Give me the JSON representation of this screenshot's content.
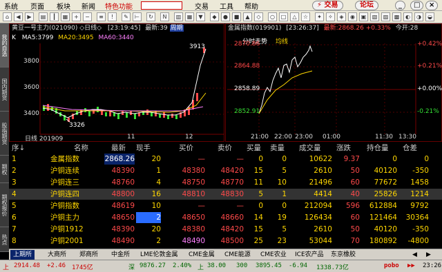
{
  "colors": {
    "up": "#ff4a4a",
    "down": "#35e035",
    "accent": "#ffd700",
    "highlight": "#0a246a"
  },
  "menu": {
    "items": [
      "系统",
      "页面",
      "板块",
      "新闻"
    ],
    "special": "特色功能",
    "tools": [
      "交易",
      "工具",
      "帮助"
    ],
    "trade_button": "⚡ 交易",
    "forum_button": "论坛"
  },
  "sidebar": {
    "tabs": [
      "我的自选",
      "国内期货",
      "股指期货",
      "期权",
      "期权报价",
      "热点"
    ]
  },
  "kline": {
    "header": "黄豆一号主力(021090) ◇日线◇",
    "time": "[23:19:45]",
    "latest": "最新:39",
    "cycle": "周期",
    "ind": "K",
    "ma5": "MA5:3799",
    "ma20": "MA20:3495",
    "ma60": "MA60:3440",
    "high_label": "3913",
    "low_label": "3326",
    "y_labels": [
      "3800",
      "3600",
      "3400"
    ],
    "x_labels": [
      "日线 201909",
      "11",
      "12"
    ]
  },
  "intraday": {
    "header": "金属指数(019901)",
    "time": "[23:26:37]",
    "latest": "最新:2868.26 +0.33%",
    "today": "今开:28",
    "legend1": "分时走势",
    "legend2": "均线",
    "y_left": [
      "2870.86",
      "2864.88",
      "2858.89",
      "2852.91"
    ],
    "y_right": [
      "+0.42%",
      "+0.21%",
      "+0.00%",
      "-0.21%"
    ],
    "x_labels": [
      "21:00",
      "22:00",
      "23:00",
      "01:00",
      "11:30",
      "13:30"
    ]
  },
  "table": {
    "headers": [
      "序↓",
      "名称",
      "最新",
      "现手",
      "买价",
      "卖价",
      "买量",
      "卖量",
      "成交量",
      "涨跌",
      "持仓量",
      "仓差"
    ],
    "rows": [
      [
        "1",
        "金属指数",
        "2868.26",
        "20",
        "—",
        "—",
        "0",
        "0",
        "10622",
        "9.37",
        "0",
        "0"
      ],
      [
        "2",
        "沪铜连续",
        "48390",
        "1",
        "48380",
        "48420",
        "15",
        "5",
        "2610",
        "50",
        "40120",
        "-350"
      ],
      [
        "3",
        "沪铜连三",
        "48760",
        "4",
        "48750",
        "48770",
        "11",
        "10",
        "21496",
        "60",
        "77672",
        "1458"
      ],
      [
        "4",
        "沪铜连四",
        "48800",
        "16",
        "48810",
        "48830",
        "5",
        "1",
        "4414",
        "40",
        "25826",
        "1214"
      ],
      [
        "5",
        "沪铜指数",
        "48619",
        "10",
        "—",
        "—",
        "0",
        "0",
        "212094",
        "596",
        "612884",
        "9792"
      ],
      [
        "6",
        "沪铜主力",
        "48650",
        "2",
        "48650",
        "48660",
        "14",
        "19",
        "126434",
        "60",
        "121464",
        "30364"
      ],
      [
        "7",
        "沪铜1912",
        "48390",
        "20",
        "48380",
        "48420",
        "15",
        "5",
        "2610",
        "50",
        "40120",
        "-350"
      ],
      [
        "8",
        "沪铜2001",
        "48490",
        "2",
        "48490",
        "48500",
        "25",
        "23",
        "53044",
        "70",
        "180892",
        "-4800"
      ]
    ]
  },
  "tabs": [
    "上期所",
    "大商所",
    "郑商所",
    "中金所",
    "LME伦敦金属",
    "CME金属",
    "CME能源",
    "CME农业",
    "ICE农产品",
    "东京橡胶"
  ],
  "status": {
    "a1": "上",
    "a2": "2914.48",
    "a3": "+2.46",
    "a4": "1745亿",
    "b1": "深",
    "b2": "9876.27",
    "b3": "2.40%",
    "c1": "上",
    "c2": "38.00",
    "c3": "300",
    "c4": "3895.45",
    "c5": "-6.94",
    "c6": "1338.73亿",
    "brand": "pobo",
    "ticker": "▶▶",
    "clock": "23:26"
  }
}
